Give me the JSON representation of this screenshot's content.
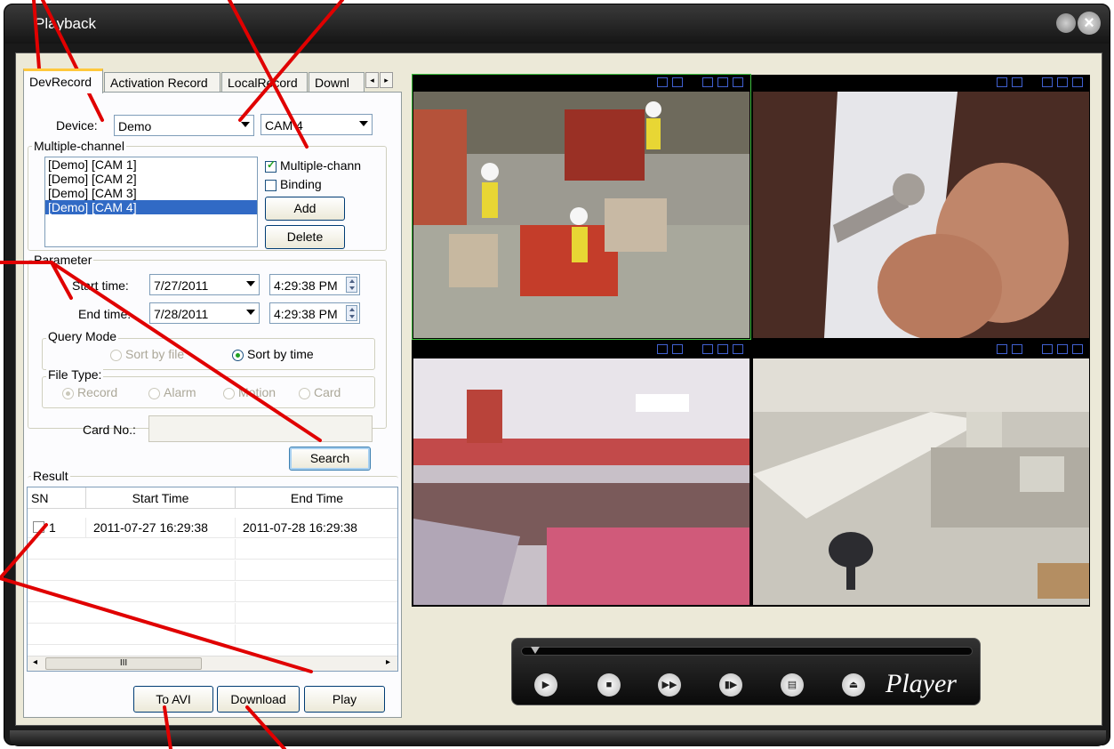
{
  "window": {
    "title": "Playback"
  },
  "tabs": [
    "DevRecord",
    "Activation Record",
    "LocalRecord",
    "Downl"
  ],
  "tab_scroll": {
    "left": "◂",
    "right": "▸"
  },
  "device": {
    "label": "Device:",
    "value": "Demo",
    "channel": "CAM 4"
  },
  "multi_channel": {
    "title": "Multiple-channel",
    "items": [
      "[Demo] [CAM 1]",
      "[Demo] [CAM 2]",
      "[Demo] [CAM 3]",
      "[Demo] [CAM 4]"
    ],
    "selected_index": 3,
    "checkbox_multi": "Multiple-chann",
    "checkbox_multi_checked": true,
    "checkbox_binding": "Binding",
    "checkbox_binding_checked": false,
    "add_label": "Add",
    "delete_label": "Delete"
  },
  "parameter": {
    "title": "Parameter",
    "start_label": "Start time:",
    "start_date": "7/27/2011",
    "start_time": "4:29:38 PM",
    "end_label": "End time:",
    "end_date": "7/28/2011",
    "end_time": "4:29:38 PM",
    "query_mode_title": "Query Mode",
    "sort_by_file": "Sort by file",
    "sort_by_time": "Sort by time",
    "file_type_title": "File Type:",
    "file_types": [
      "Record",
      "Alarm",
      "Motion",
      "Card"
    ],
    "card_label": "Card No.:",
    "card_value": "",
    "search_label": "Search"
  },
  "result": {
    "title": "Result",
    "columns": [
      "SN",
      "Start Time",
      "End Time"
    ],
    "rows": [
      {
        "sn": "1",
        "start": "2011-07-27 16:29:38",
        "end": "2011-07-28 16:29:38"
      }
    ],
    "scroll_thumb": "III",
    "scroll_left": "◂",
    "scroll_right": "▸"
  },
  "actions": {
    "to_avi": "To AVI",
    "download": "Download",
    "play": "Play"
  },
  "player": {
    "label": "Player"
  },
  "colors": {
    "accent_red": "#e00000",
    "tab_highlight": "#ffc83c",
    "selection": "#316ac5"
  }
}
